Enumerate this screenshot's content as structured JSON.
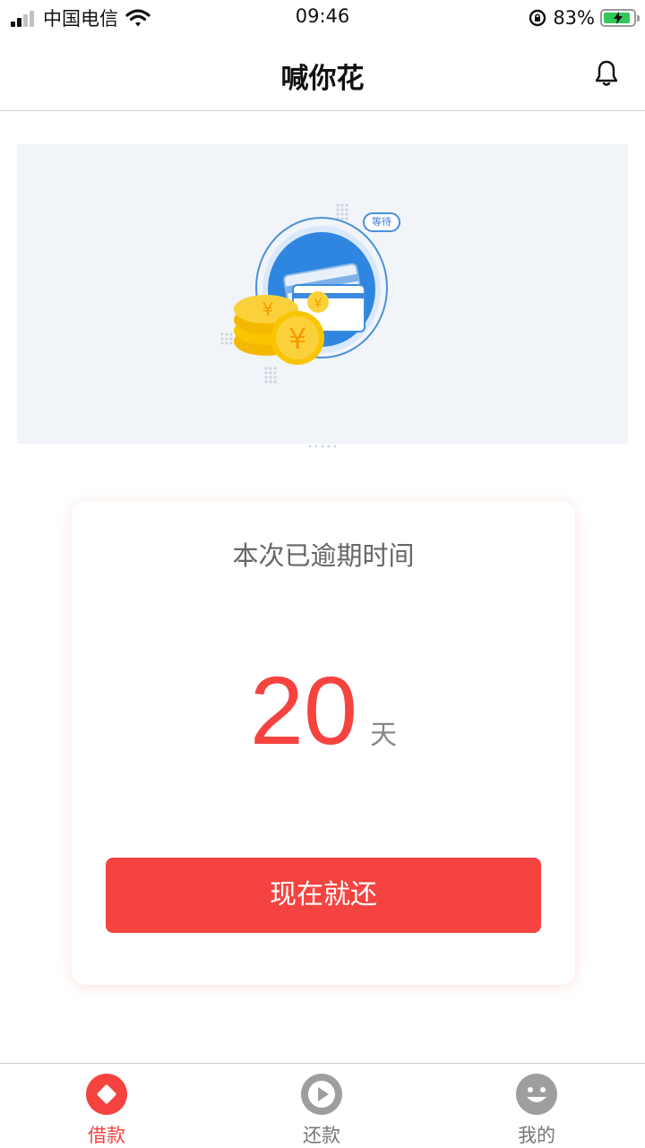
{
  "status_bar": {
    "carrier": "中国电信",
    "time": "09:46",
    "battery": "83%",
    "battery_level": 0.83
  },
  "header": {
    "title": "喊你花",
    "bell_icon": "bell-icon"
  },
  "banner": {
    "badge_text": "等待"
  },
  "card": {
    "label": "本次已逾期时间",
    "days_value": "20",
    "days_unit": "天",
    "button_label": "现在就还"
  },
  "tabbar": {
    "items": [
      {
        "label": "借款",
        "icon": "diamond-icon",
        "active": true
      },
      {
        "label": "还款",
        "icon": "play-icon",
        "active": false
      },
      {
        "label": "我的",
        "icon": "smile-icon",
        "active": false
      }
    ]
  },
  "colors": {
    "accent": "#f5433f",
    "banner_bg": "#f1f4f8",
    "card_blue": "#2b8fe8",
    "coin_yellow": "#f9c400"
  }
}
